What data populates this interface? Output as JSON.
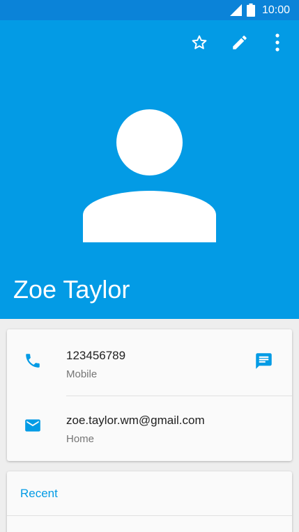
{
  "status_bar": {
    "time": "10:00",
    "icons": [
      "signal-icon",
      "battery-icon"
    ]
  },
  "colors": {
    "header": "#039be5",
    "status_bar": "#0b83d8",
    "accent": "#039be5"
  },
  "toolbar": {
    "icons": [
      "star-outline-icon",
      "edit-pencil-icon",
      "more-vert-icon"
    ]
  },
  "contact": {
    "name": "Zoe Taylor",
    "avatar_icon": "person-silhouette-icon"
  },
  "details": [
    {
      "value": "123456789",
      "type": "Mobile",
      "icon": "phone-icon",
      "action_icon": "message-icon"
    },
    {
      "value": "zoe.taylor.wm@gmail.com",
      "type": "Home",
      "icon": "email-icon"
    }
  ],
  "recent": {
    "title": "Recent"
  }
}
